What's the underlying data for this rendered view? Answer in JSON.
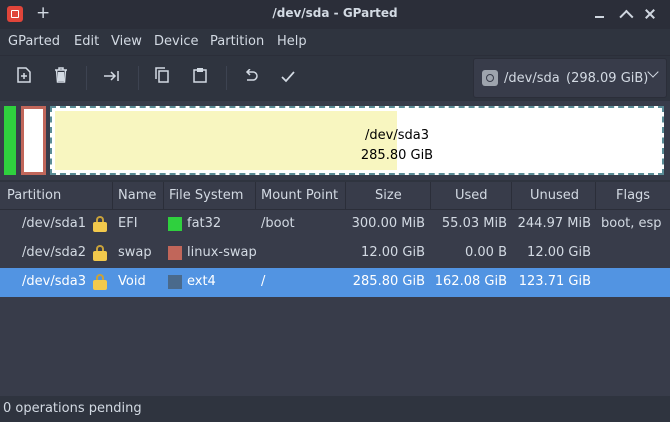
{
  "window": {
    "title": "/dev/sda - GParted",
    "new_tab": "+"
  },
  "menu": [
    "GParted",
    "Edit",
    "View",
    "Device",
    "Partition",
    "Help"
  ],
  "toolbar": {
    "device_name": "/dev/sda",
    "device_size": "(298.09 GiB)"
  },
  "map": {
    "sda3_name": "/dev/sda3",
    "sda3_size": "285.80 GiB",
    "sda3_used_fraction": 0.567
  },
  "table": {
    "headers": [
      "Partition",
      "Name",
      "File System",
      "Mount Point",
      "Size",
      "Used",
      "Unused",
      "Flags"
    ],
    "rows": [
      {
        "partition": "/dev/sda1",
        "name": "EFI",
        "fs": "fat32",
        "fs_color": "#2fd03e",
        "mount": "/boot",
        "size": "300.00 MiB",
        "used": "55.03 MiB",
        "unused": "244.97 MiB",
        "flags": "boot, esp"
      },
      {
        "partition": "/dev/sda2",
        "name": "swap",
        "fs": "linux-swap",
        "fs_color": "#c1665a",
        "mount": "",
        "size": "12.00 GiB",
        "used": "0.00 B",
        "unused": "12.00 GiB",
        "flags": ""
      },
      {
        "partition": "/dev/sda3",
        "name": "Void",
        "fs": "ext4",
        "fs_color": "#4a6a8c",
        "mount": "/",
        "size": "285.80 GiB",
        "used": "162.08 GiB",
        "unused": "123.71 GiB",
        "flags": ""
      }
    ]
  },
  "status": {
    "text": "0 operations pending"
  }
}
